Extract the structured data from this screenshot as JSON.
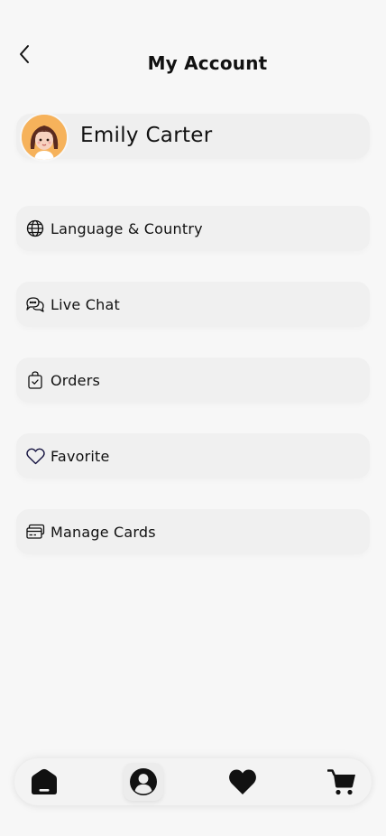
{
  "header": {
    "title": "My Account",
    "back_icon": "chevron-left-icon"
  },
  "profile": {
    "name": "Emily Carter",
    "avatar": "girl-avatar"
  },
  "menu": [
    {
      "label": "Language & Country",
      "icon": "globe-icon"
    },
    {
      "label": "Live Chat",
      "icon": "chat-bubbles-icon"
    },
    {
      "label": "Orders",
      "icon": "shopping-bag-check-icon"
    },
    {
      "label": "Favorite",
      "icon": "heart-outline-icon"
    },
    {
      "label": "Manage Cards",
      "icon": "credit-cards-icon"
    }
  ],
  "bottom_nav": [
    {
      "icon": "home-icon",
      "active": false
    },
    {
      "icon": "user-profile-icon",
      "active": true
    },
    {
      "icon": "heart-icon",
      "active": false
    },
    {
      "icon": "cart-icon",
      "active": false
    }
  ],
  "colors": {
    "background": "#f7f7f7",
    "card": "#f0f0f0",
    "icon": "#111111",
    "avatar_bg": "#f6b25b"
  }
}
